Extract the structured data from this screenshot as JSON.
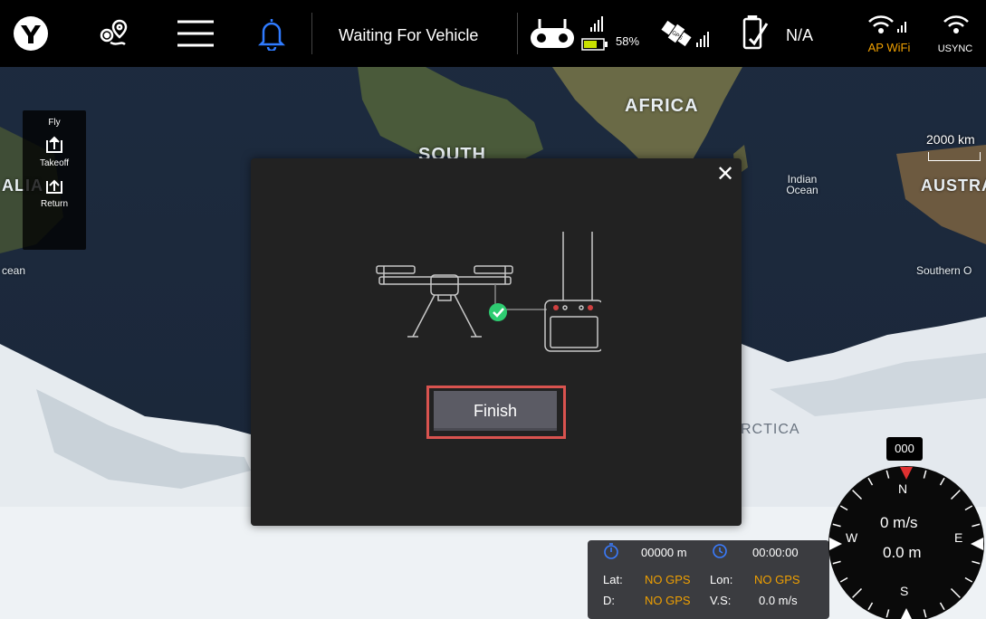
{
  "topbar": {
    "status_text": "Waiting For Vehicle",
    "controller_battery": "58%",
    "vehicle_battery": "N/A",
    "wifi_label": "AP WiFi",
    "usync_label": "USYNC",
    "icons": [
      "app-logo-icon",
      "waypoint-icon",
      "menu-icon",
      "bell-icon",
      "remote-controller-icon",
      "signal-icon",
      "battery-icon",
      "gps-satellite-icon",
      "vehicle-battery-icon",
      "wifi-icon",
      "usync-icon"
    ],
    "accent_color": "#f0a000",
    "bell_color": "#2f7bff"
  },
  "map": {
    "labels": {
      "africa": "AFRICA",
      "south": "SOUTH",
      "alia": "ALIA",
      "austra": "AUSTRA",
      "indian_ocean_1": "Indian",
      "indian_ocean_2": "Ocean",
      "cean": "cean",
      "southern": "Southern O",
      "antarctica": "RCTICA"
    },
    "scale": "2000 km"
  },
  "fly_panel": {
    "title": "Fly",
    "takeoff": "Takeoff",
    "return": "Return"
  },
  "modal": {
    "close": "✕",
    "finish_label": "Finish",
    "highlight_color": "#d9534f"
  },
  "telemetry": {
    "distance": "00000 m",
    "time": "00:00:00",
    "lat_label": "Lat:",
    "lat_value": "NO GPS",
    "lon_label": "Lon:",
    "lon_value": "NO GPS",
    "d_label": "D:",
    "d_value": "NO GPS",
    "vs_label": "V.S:",
    "vs_value": "0.0 m/s"
  },
  "compass": {
    "heading": "000",
    "n": "N",
    "s": "S",
    "e": "E",
    "w": "W",
    "speed": "0 m/s",
    "altitude": "0.0 m"
  }
}
